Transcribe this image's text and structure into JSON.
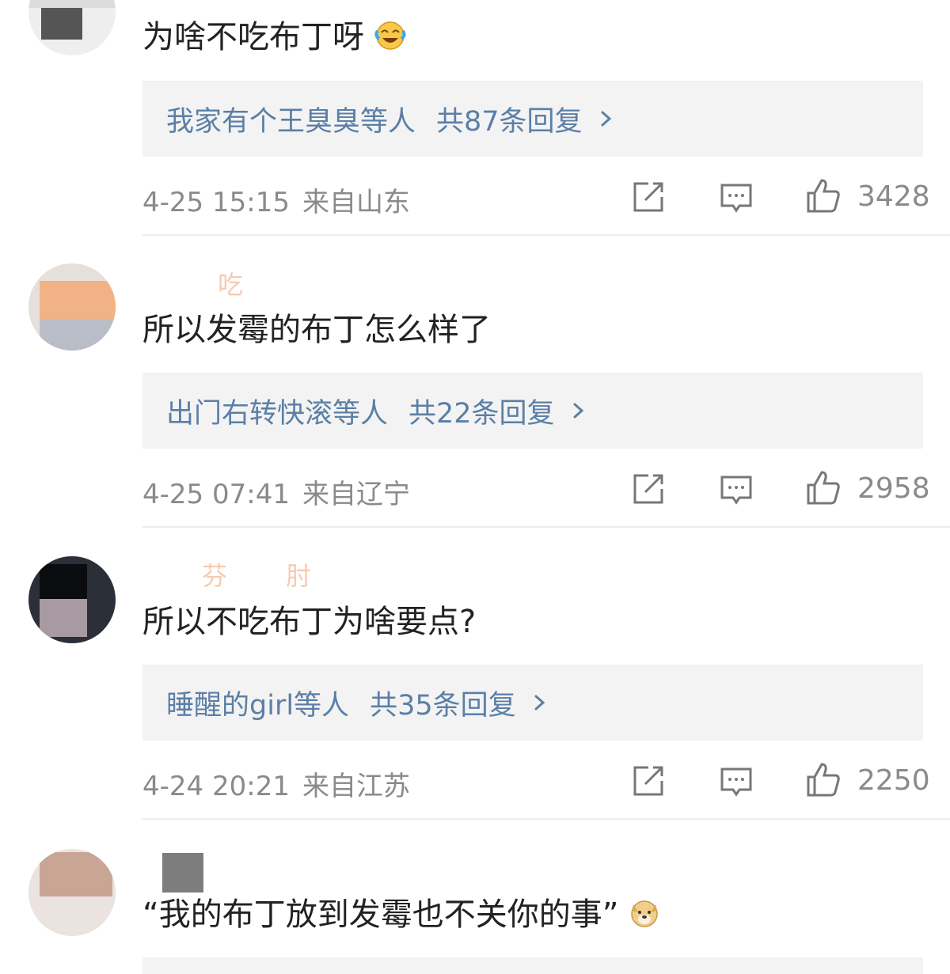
{
  "comments": [
    {
      "text": "为啥不吃布丁呀",
      "reply_users": "我家有个王臭臭等人",
      "reply_count": "共87条回复",
      "time": "4-25 15:15",
      "location": "来自山东",
      "likes": "3428",
      "emoji": "laugh-cry"
    },
    {
      "username": "吃",
      "text": "所以发霉的布丁怎么样了",
      "reply_users": "出门右转快滚等人",
      "reply_count": "共22条回复",
      "time": "4-25 07:41",
      "location": "来自辽宁",
      "likes": "2958"
    },
    {
      "username": "芬 肘",
      "text": "所以不吃布丁为啥要点?",
      "reply_users": "睡醒的girl等人",
      "reply_count": "共35条回复",
      "time": "4-24 20:21",
      "location": "来自江苏",
      "likes": "2250"
    },
    {
      "text": "“我的布丁放到发霉也不关你的事”",
      "emoji": "doge"
    }
  ],
  "colors": {
    "link": "#5b7fa6",
    "meta": "#8a8a8a",
    "reply_bg": "#f3f3f3"
  },
  "icons": [
    "share-icon",
    "comment-icon",
    "thumbs-up-icon",
    "chevron-right-icon",
    "laugh-cry-emoji",
    "doge-emoji"
  ]
}
